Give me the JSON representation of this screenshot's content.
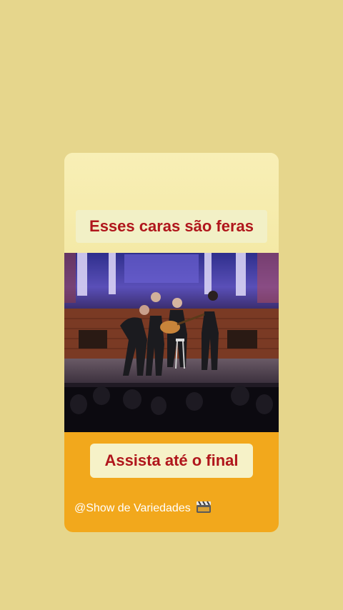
{
  "story": {
    "headline": "Esses caras são feras",
    "cta": "Assista até o final",
    "handle": "@Show de Variedades",
    "handle_icon": "clapperboard-icon"
  },
  "colors": {
    "page_background": "#e6d68c",
    "card_top": "#f7eeb0",
    "card_bottom": "#f2a81c",
    "text_red": "#b0161c",
    "text_white": "#ffffff"
  }
}
